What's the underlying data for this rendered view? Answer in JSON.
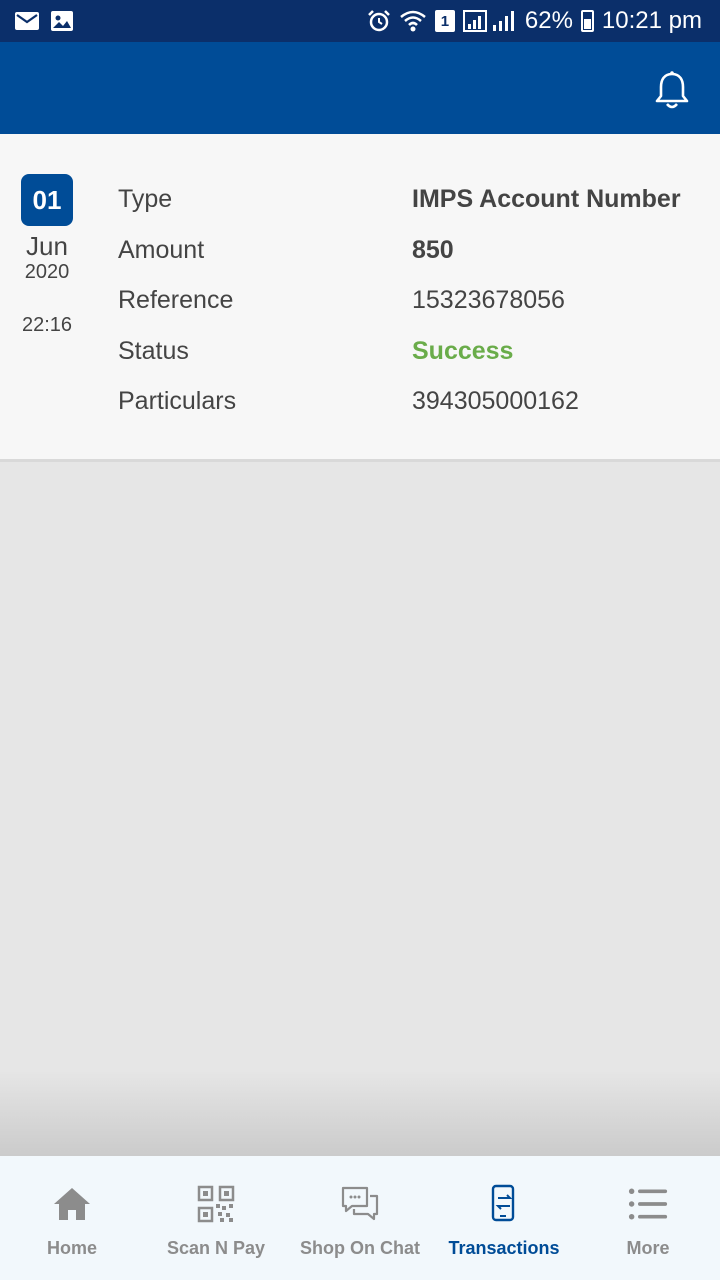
{
  "status_bar": {
    "left_icons": [
      "mail-icon",
      "image-icon"
    ],
    "right_icons": [
      "alarm-icon",
      "wifi-icon",
      "signal-icon"
    ],
    "sim_label": "1",
    "battery": "62%",
    "time": "10:21 pm"
  },
  "app_bar": {
    "notification_icon": "bell-icon"
  },
  "transaction": {
    "date": {
      "day": "01",
      "month": "Jun",
      "year": "2020",
      "time": "22:16"
    },
    "fields": [
      {
        "label": "Type",
        "value": "IMPS Account Number"
      },
      {
        "label": "Amount",
        "value": "850"
      },
      {
        "label": "Reference",
        "value": "15323678056"
      },
      {
        "label": "Status",
        "value": "Success"
      },
      {
        "label": "Particulars",
        "value": "394305000162"
      }
    ]
  },
  "bottom_nav": {
    "items": [
      {
        "label": "Home",
        "icon": "home-icon",
        "active": false
      },
      {
        "label": "Scan N Pay",
        "icon": "qr-code-icon",
        "active": false
      },
      {
        "label": "Shop On Chat",
        "icon": "chat-bubbles-icon",
        "active": false
      },
      {
        "label": "Transactions",
        "icon": "phone-transfer-icon",
        "active": true
      },
      {
        "label": "More",
        "icon": "list-menu-icon",
        "active": false
      }
    ]
  },
  "colors": {
    "primary": "#004c97",
    "status_bar": "#0b2f6a",
    "success": "#6aac4a",
    "inactive_nav": "#8c8c8c"
  }
}
